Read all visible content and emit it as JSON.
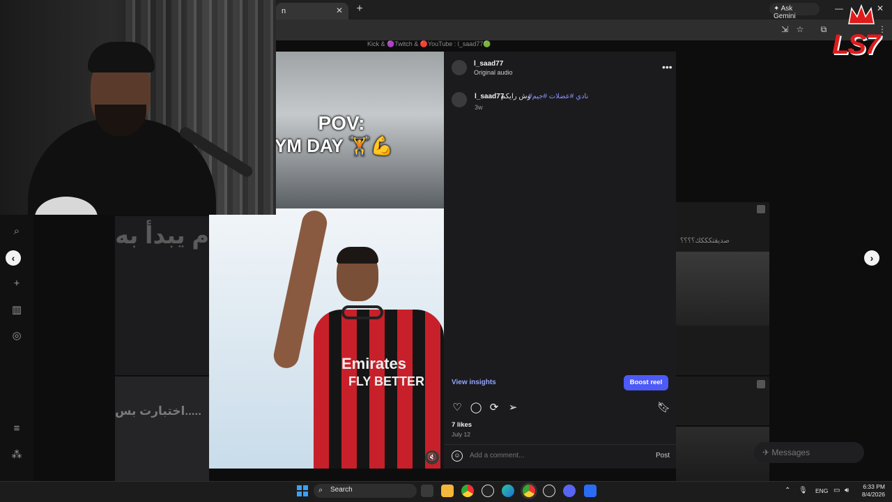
{
  "browser": {
    "tab_title": "n",
    "new_tab": "+",
    "ask_gemini": "Ask Gemini",
    "win_min": "—",
    "win_close": "✕"
  },
  "page": {
    "top_banner": "Kick & 🟣Twitch & 🔴YouTube : l_saad77🟢",
    "bg_arabic_top": "م يبدأ به",
    "bg_arabic_bottom": "اختبارت بس.....",
    "right_tile_caption": "صديقتكككك؟؟؟؟",
    "messages_label": "Messages"
  },
  "reel": {
    "overlay_line1": "POV:",
    "overlay_line2": "YM DAY 🏋️💪",
    "jersey_text": "Emirates",
    "jersey_text2": "FLY BETTER"
  },
  "panel": {
    "username": "l_saad77",
    "audio": "Original audio",
    "more": "•••",
    "caption_user": "l_saad77",
    "caption_text": "وش رايكم",
    "caption_tags": "#نادي #عضلات #جيم",
    "caption_time": "3w",
    "view_insights": "View insights",
    "boost_reel": "Boost reel",
    "likes": "7 likes",
    "date": "July 12",
    "comment_placeholder": "Add a comment...",
    "post": "Post"
  },
  "logo": {
    "text": "LS7"
  },
  "taskbar": {
    "search": "Search",
    "lang": "ENG",
    "time": "6:33 PM",
    "date": "8/4/2026"
  },
  "colors": {
    "accent_blue": "#4d5af6",
    "link_blue": "#93a5ff",
    "hashtag": "#8b95ff",
    "logo_red": "#e01b1b"
  }
}
